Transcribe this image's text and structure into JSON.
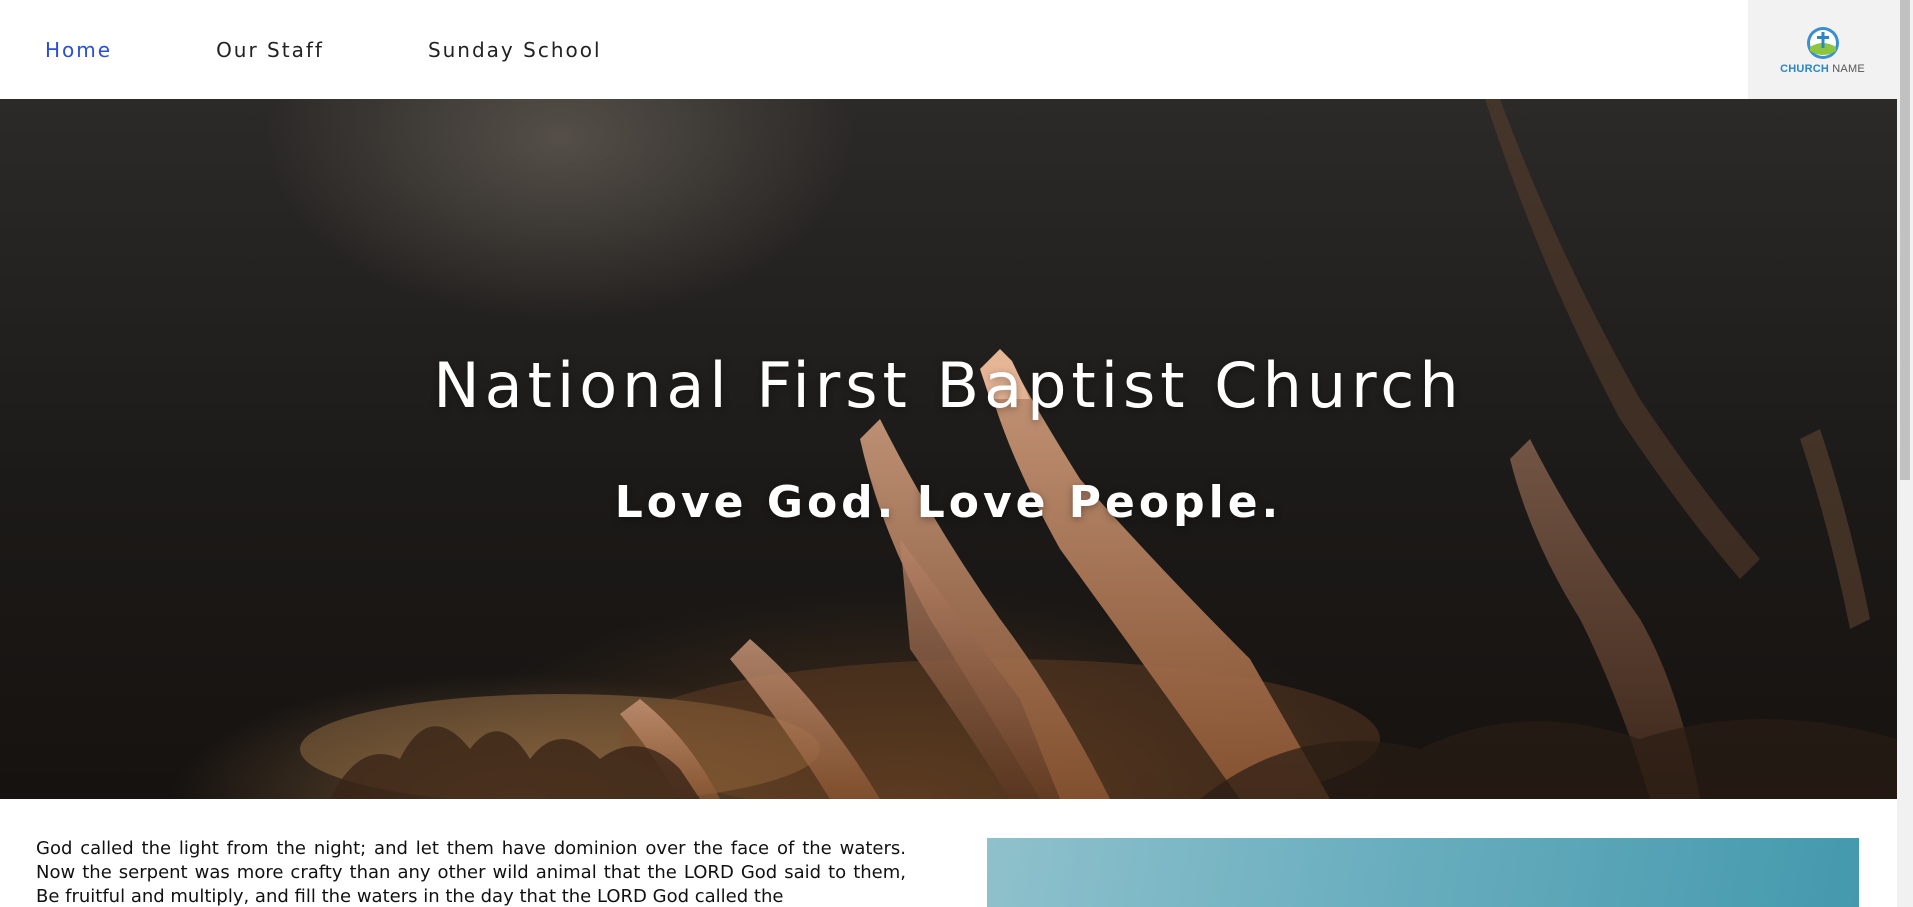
{
  "nav": {
    "items": [
      {
        "label": "Home",
        "active": true
      },
      {
        "label": "Our Staff",
        "active": false
      },
      {
        "label": "Sunday School",
        "active": false
      }
    ],
    "active_color": "#2a4fd6"
  },
  "logo": {
    "word1": "CHURCH",
    "word2": " NAME",
    "icon": "church-cross-icon",
    "word1_color": "#2b86c4"
  },
  "hero": {
    "title": "National First Baptist Church",
    "subtitle": "Love God. Love People."
  },
  "content": {
    "intro_text": "God called the light from the night; and let them have dominion over the face of the waters. Now the serpent was more crafty than any other wild animal that the LORD God said to them, Be fruitful and multiply, and fill the waters in the day that the LORD God called the"
  }
}
